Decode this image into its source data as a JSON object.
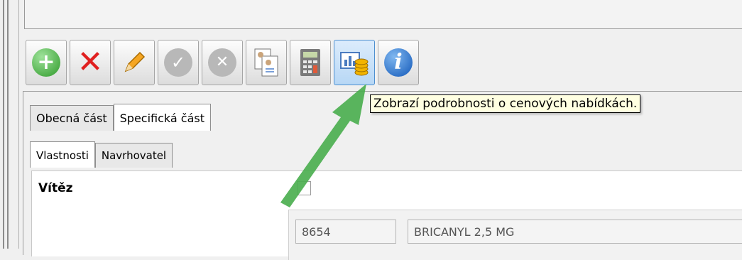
{
  "toolbar": {
    "buttons": [
      {
        "name": "add",
        "icon": "plus-icon"
      },
      {
        "name": "delete",
        "icon": "x-icon"
      },
      {
        "name": "edit",
        "icon": "pencil-icon"
      },
      {
        "name": "confirm",
        "icon": "check-icon",
        "disabled": true
      },
      {
        "name": "cancel",
        "icon": "cancel-icon",
        "disabled": true
      },
      {
        "name": "copy",
        "icon": "document-copy-icon"
      },
      {
        "name": "calculator",
        "icon": "calculator-icon"
      },
      {
        "name": "price-offers",
        "icon": "chart-coins-icon",
        "active": true
      },
      {
        "name": "info",
        "icon": "info-icon"
      }
    ]
  },
  "tooltip": "Zobrazí podrobnosti o cenových nabídkách.",
  "tabs": {
    "main": [
      "Obecná část",
      "Specifická část"
    ],
    "main_selected": 1,
    "sub": [
      "Vlastnosti",
      "Navrhovatel"
    ],
    "sub_selected": 0
  },
  "form": {
    "vitez_label": "Vítěz",
    "code_value": "8654",
    "name_value": "BRICANYL 2,5 MG"
  },
  "colors": {
    "arrow": "#4caf50",
    "tooltip_bg": "#ffffe1",
    "active_button": "#b7d7f5"
  }
}
